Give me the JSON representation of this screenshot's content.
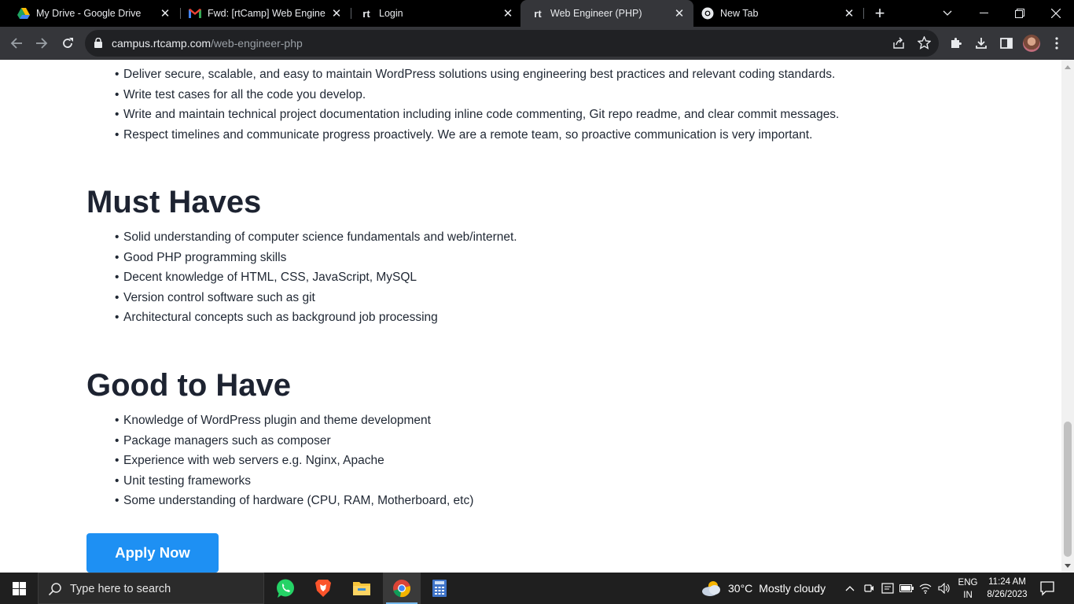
{
  "browser": {
    "tabs": [
      {
        "title": "My Drive - Google Drive",
        "icon": "google-drive-icon",
        "active": false
      },
      {
        "title": "Fwd: [rtCamp] Web Engineer",
        "icon": "gmail-icon",
        "active": false
      },
      {
        "title": "Login",
        "icon": "rtcamp-icon",
        "active": false
      },
      {
        "title": "Web Engineer (PHP)",
        "icon": "rtcamp-icon",
        "active": true
      },
      {
        "title": "New Tab",
        "icon": "chrome-icon",
        "active": false
      }
    ],
    "rt_glyph": "rt",
    "address": {
      "domain": "campus.rtcamp.com",
      "path": "/web-engineer-php"
    }
  },
  "page": {
    "responsibilities": [
      "Deliver secure, scalable, and easy to maintain WordPress solutions using engineering best practices and relevant coding standards.",
      "Write test cases for all the code you develop.",
      "Write and maintain technical project documentation including inline code commenting, Git repo readme, and clear commit messages.",
      "Respect timelines and communicate progress proactively. We are a remote team, so proactive communication is very important."
    ],
    "must_haves": {
      "heading": "Must Haves",
      "items": [
        "Solid understanding of computer science fundamentals and web/internet.",
        "Good PHP programming skills",
        "Decent knowledge of HTML, CSS, JavaScript, MySQL",
        "Version control software such as git",
        "Architectural concepts such as background job processing"
      ]
    },
    "good_to_have": {
      "heading": "Good to Have",
      "items": [
        "Knowledge of WordPress plugin and theme development",
        "Package managers such as composer",
        "Experience with web servers e.g. Nginx, Apache",
        "Unit testing frameworks",
        "Some understanding of hardware (CPU, RAM, Motherboard, etc)"
      ]
    },
    "apply_label": "Apply Now"
  },
  "taskbar": {
    "search_placeholder": "Type here to search",
    "pinned_apps": [
      "whatsapp-icon",
      "brave-icon",
      "file-explorer-icon",
      "chrome-icon",
      "calculator-icon"
    ],
    "weather": {
      "temp": "30°C",
      "condition": "Mostly cloudy"
    },
    "language": {
      "line1": "ENG",
      "line2": "IN"
    },
    "clock": {
      "time": "11:24 AM",
      "date": "8/26/2023"
    }
  },
  "colors": {
    "accent": "#1e90f3",
    "heading": "#1d2331",
    "body_text": "#1f2733"
  }
}
